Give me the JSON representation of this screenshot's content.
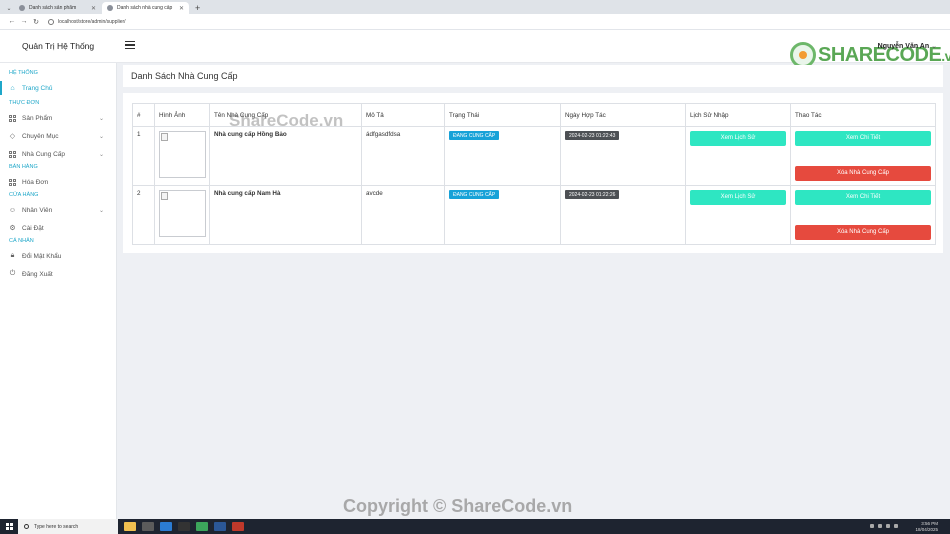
{
  "browser": {
    "tabs": [
      {
        "label": "Danh sách sản phẩm",
        "active": false
      },
      {
        "label": "Danh sách nhà cung cấp",
        "active": true
      }
    ],
    "url": "localhost/store/admin/supplier/"
  },
  "header": {
    "brand": "Quản Trị Hệ Thống",
    "user": "Nguyễn Văn An",
    "logo": {
      "share": "SHARECODE",
      "tld": ".vn"
    }
  },
  "sidebar": {
    "sections": [
      {
        "title": "HỆ THỐNG",
        "items": [
          {
            "label": "Trang Chủ",
            "icon": "home-icon",
            "active": true
          }
        ]
      },
      {
        "title": "THỰC ĐƠN",
        "items": [
          {
            "label": "Sản Phẩm",
            "icon": "grid-icon",
            "chevron": true
          },
          {
            "label": "Chuyên Mục",
            "icon": "tag-icon",
            "chevron": true
          },
          {
            "label": "Nhà Cung Cấp",
            "icon": "grid-icon",
            "chevron": true
          }
        ]
      },
      {
        "title": "BÁN HÀNG",
        "items": [
          {
            "label": "Hóa Đơn",
            "icon": "grid-icon"
          }
        ]
      },
      {
        "title": "CỬA HÀNG",
        "items": [
          {
            "label": "Nhân Viên",
            "icon": "user-icon",
            "chevron": true
          },
          {
            "label": "Cài Đặt",
            "icon": "gear-icon"
          }
        ]
      },
      {
        "title": "CÁ NHÂN",
        "items": [
          {
            "label": "Đổi Mật Khẩu",
            "icon": "lock-icon"
          },
          {
            "label": "Đăng Xuất",
            "icon": "logout-icon"
          }
        ]
      }
    ]
  },
  "page": {
    "title": "Danh Sách Nhà Cung Cấp",
    "table": {
      "headers": [
        "#",
        "Hình Ảnh",
        "Tên Nhà Cung Cấp",
        "Mô Tả",
        "Trạng Thái",
        "Ngày Hợp Tác",
        "Lịch Sử Nhập",
        "Thao Tác"
      ],
      "rows": [
        {
          "index": "1",
          "name": "Nhà cung cấp Hồng Bảo",
          "description": "ádfgasdfdsa",
          "status": "ĐANG CUNG CẤP",
          "date": "2024-02-23 01:22:43"
        },
        {
          "index": "2",
          "name": "Nhà cung cấp Nam Hà",
          "description": "avcde",
          "status": "ĐANG CUNG CẤP",
          "date": "2024-02-23 01:22:26"
        }
      ],
      "history_button": "Xem Lịch Sử",
      "detail_button": "Xem Chi Tiết",
      "delete_button": "Xóa Nhà Cung Cấp"
    }
  },
  "watermarks": {
    "top": "ShareCode.vn",
    "bottom": "Copyright © ShareCode.vn"
  },
  "taskbar": {
    "search_placeholder": "Type here to search",
    "time": "3:56 PM",
    "date": "18/04/2025"
  },
  "colors": {
    "accent": "#1fa7c9",
    "teal_button": "#2ee6c2",
    "red_button": "#e64a3e",
    "status_badge": "#17a2d8",
    "date_badge": "#4d5054"
  }
}
